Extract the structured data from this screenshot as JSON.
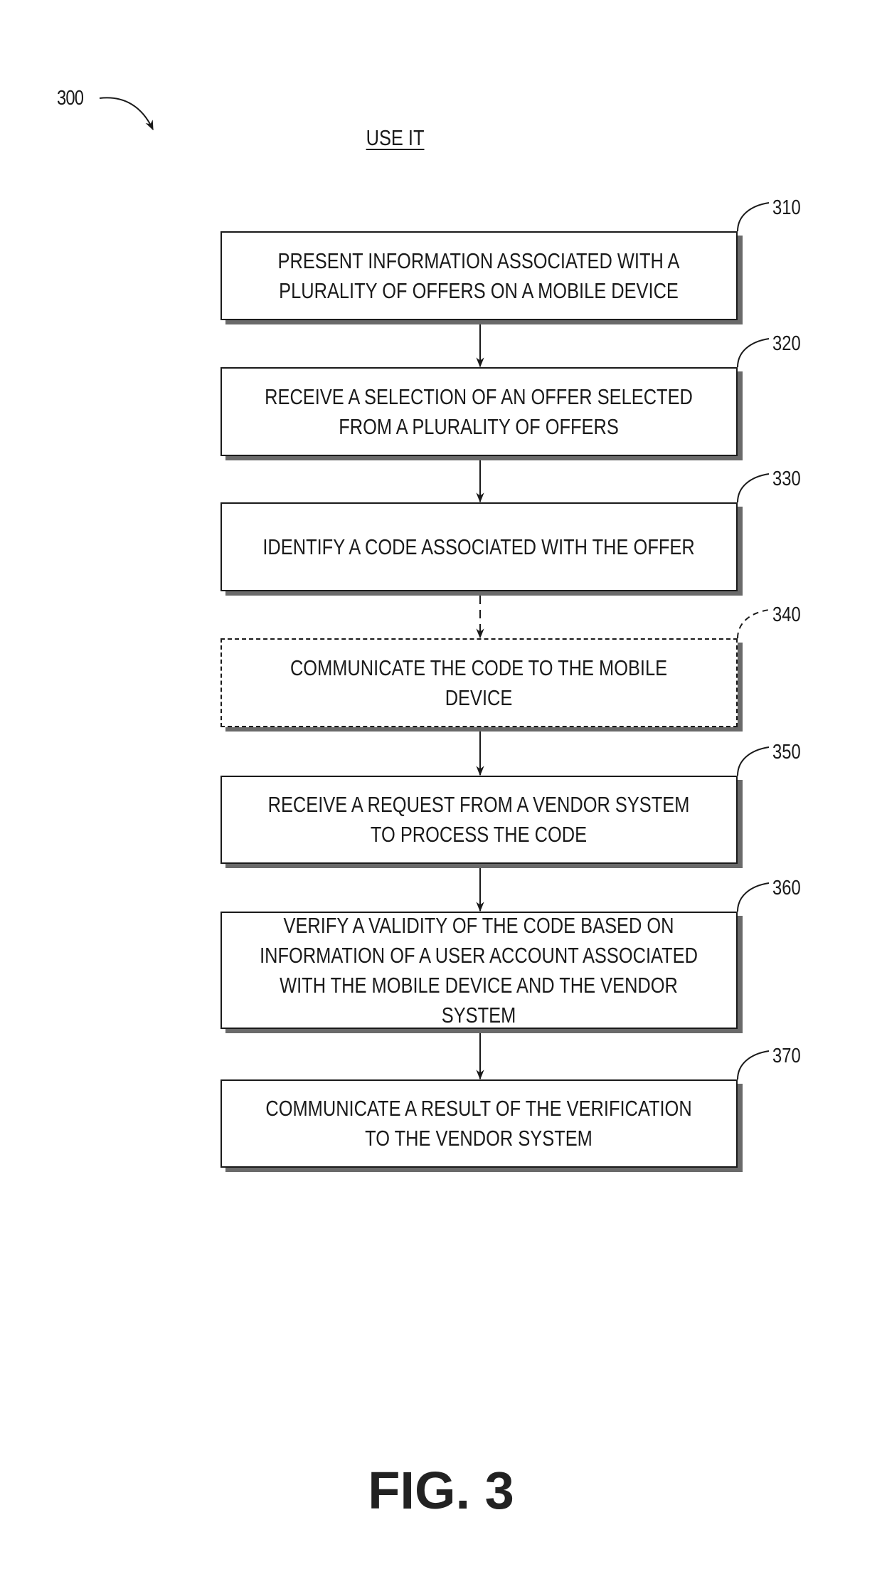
{
  "figure": {
    "reference_numeral": "300",
    "title": "USE IT",
    "label": "FIG. 3"
  },
  "steps": [
    {
      "id": "310",
      "text": "PRESENT INFORMATION ASSOCIATED WITH A\nPLURALITY OF OFFERS ON A MOBILE DEVICE",
      "optional": false
    },
    {
      "id": "320",
      "text": "RECEIVE A SELECTION OF AN OFFER SELECTED\nFROM A PLURALITY OF OFFERS",
      "optional": false
    },
    {
      "id": "330",
      "text": "IDENTIFY A CODE ASSOCIATED WITH THE OFFER",
      "optional": false
    },
    {
      "id": "340",
      "text": "COMMUNICATE THE CODE TO THE MOBILE\nDEVICE",
      "optional": true
    },
    {
      "id": "350",
      "text": "RECEIVE A REQUEST FROM A VENDOR SYSTEM\nTO PROCESS THE CODE",
      "optional": false
    },
    {
      "id": "360",
      "text": "VERIFY A VALIDITY OF THE CODE BASED ON\nINFORMATION OF A USER ACCOUNT ASSOCIATED\nWITH THE MOBILE DEVICE AND THE VENDOR\nSYSTEM",
      "optional": false
    },
    {
      "id": "370",
      "text": "COMMUNICATE A RESULT OF THE VERIFICATION\nTO THE VENDOR SYSTEM",
      "optional": false
    }
  ],
  "flow": [
    {
      "from": "310",
      "to": "320",
      "style": "solid"
    },
    {
      "from": "320",
      "to": "330",
      "style": "solid"
    },
    {
      "from": "330",
      "to": "340",
      "style": "dashed"
    },
    {
      "from": "340",
      "to": "350",
      "style": "solid"
    },
    {
      "from": "350",
      "to": "360",
      "style": "solid"
    },
    {
      "from": "360",
      "to": "370",
      "style": "solid"
    }
  ]
}
